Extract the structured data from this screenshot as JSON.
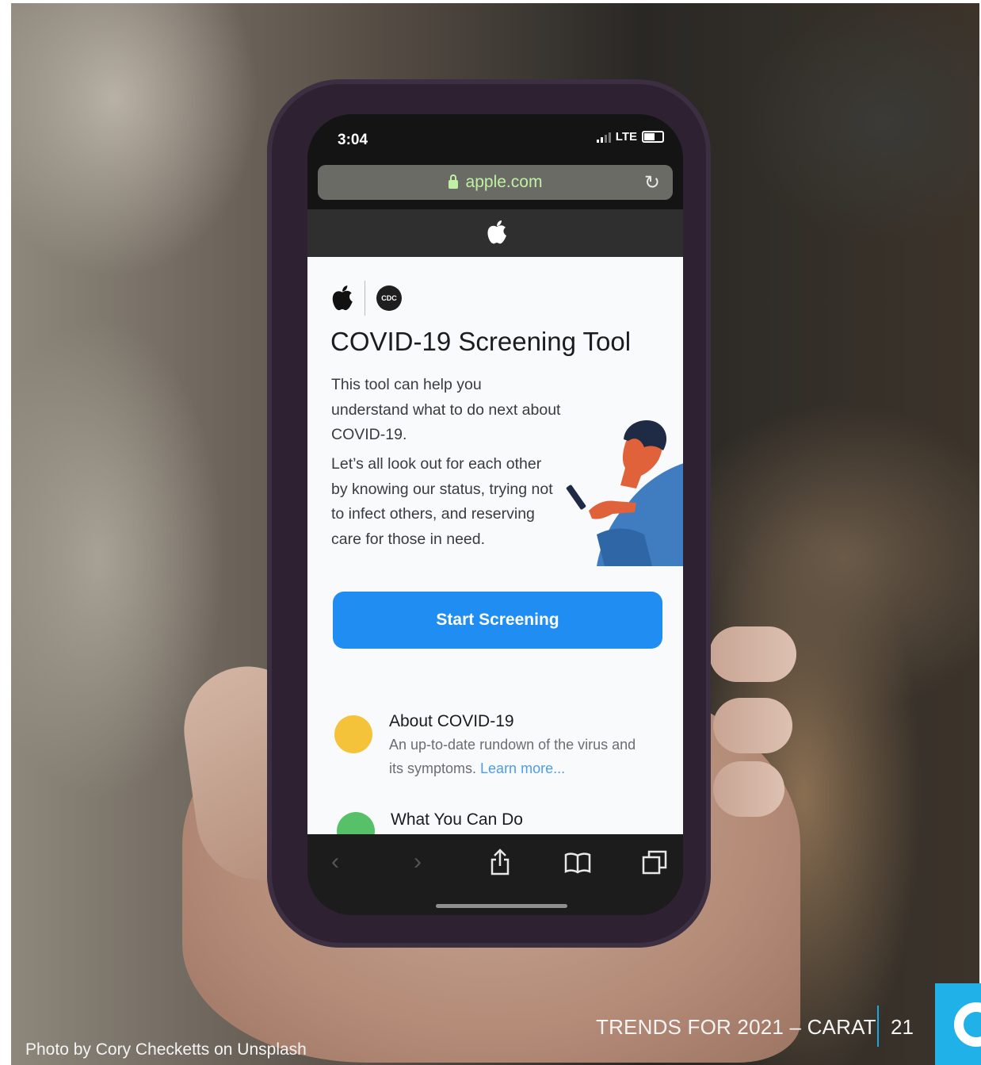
{
  "phone": {
    "status_time": "3:04",
    "status_network": "LTE",
    "url": "apple.com",
    "page": {
      "cdc_logo_text": "CDC",
      "title": "COVID-19 Screening Tool",
      "intro": "This tool can help you understand what to do next about COVID-19.",
      "body": "Let’s all look out for each other by knowing our status, trying not to infect others, and reserving care for those in need.",
      "start_button": "Start Screening",
      "items": [
        {
          "title": "About COVID-19",
          "description": "An up-to-date rundown of the virus and its symptoms.",
          "link": "Learn more..."
        },
        {
          "title": "What You Can Do"
        }
      ]
    },
    "toolbar_icons": [
      "back-icon",
      "forward-icon",
      "share-icon",
      "bookmarks-icon",
      "tabs-icon"
    ]
  },
  "slide": {
    "photo_credit": "Photo by Cory Checketts on Unsplash",
    "footer_title": "TRENDS FOR 2021 – CARAT",
    "page_number": "21"
  },
  "colors": {
    "start_button": "#1f8df1",
    "url_text": "#bff0a4",
    "link": "#4b9cf2",
    "accent_line": "#1da7e1"
  }
}
